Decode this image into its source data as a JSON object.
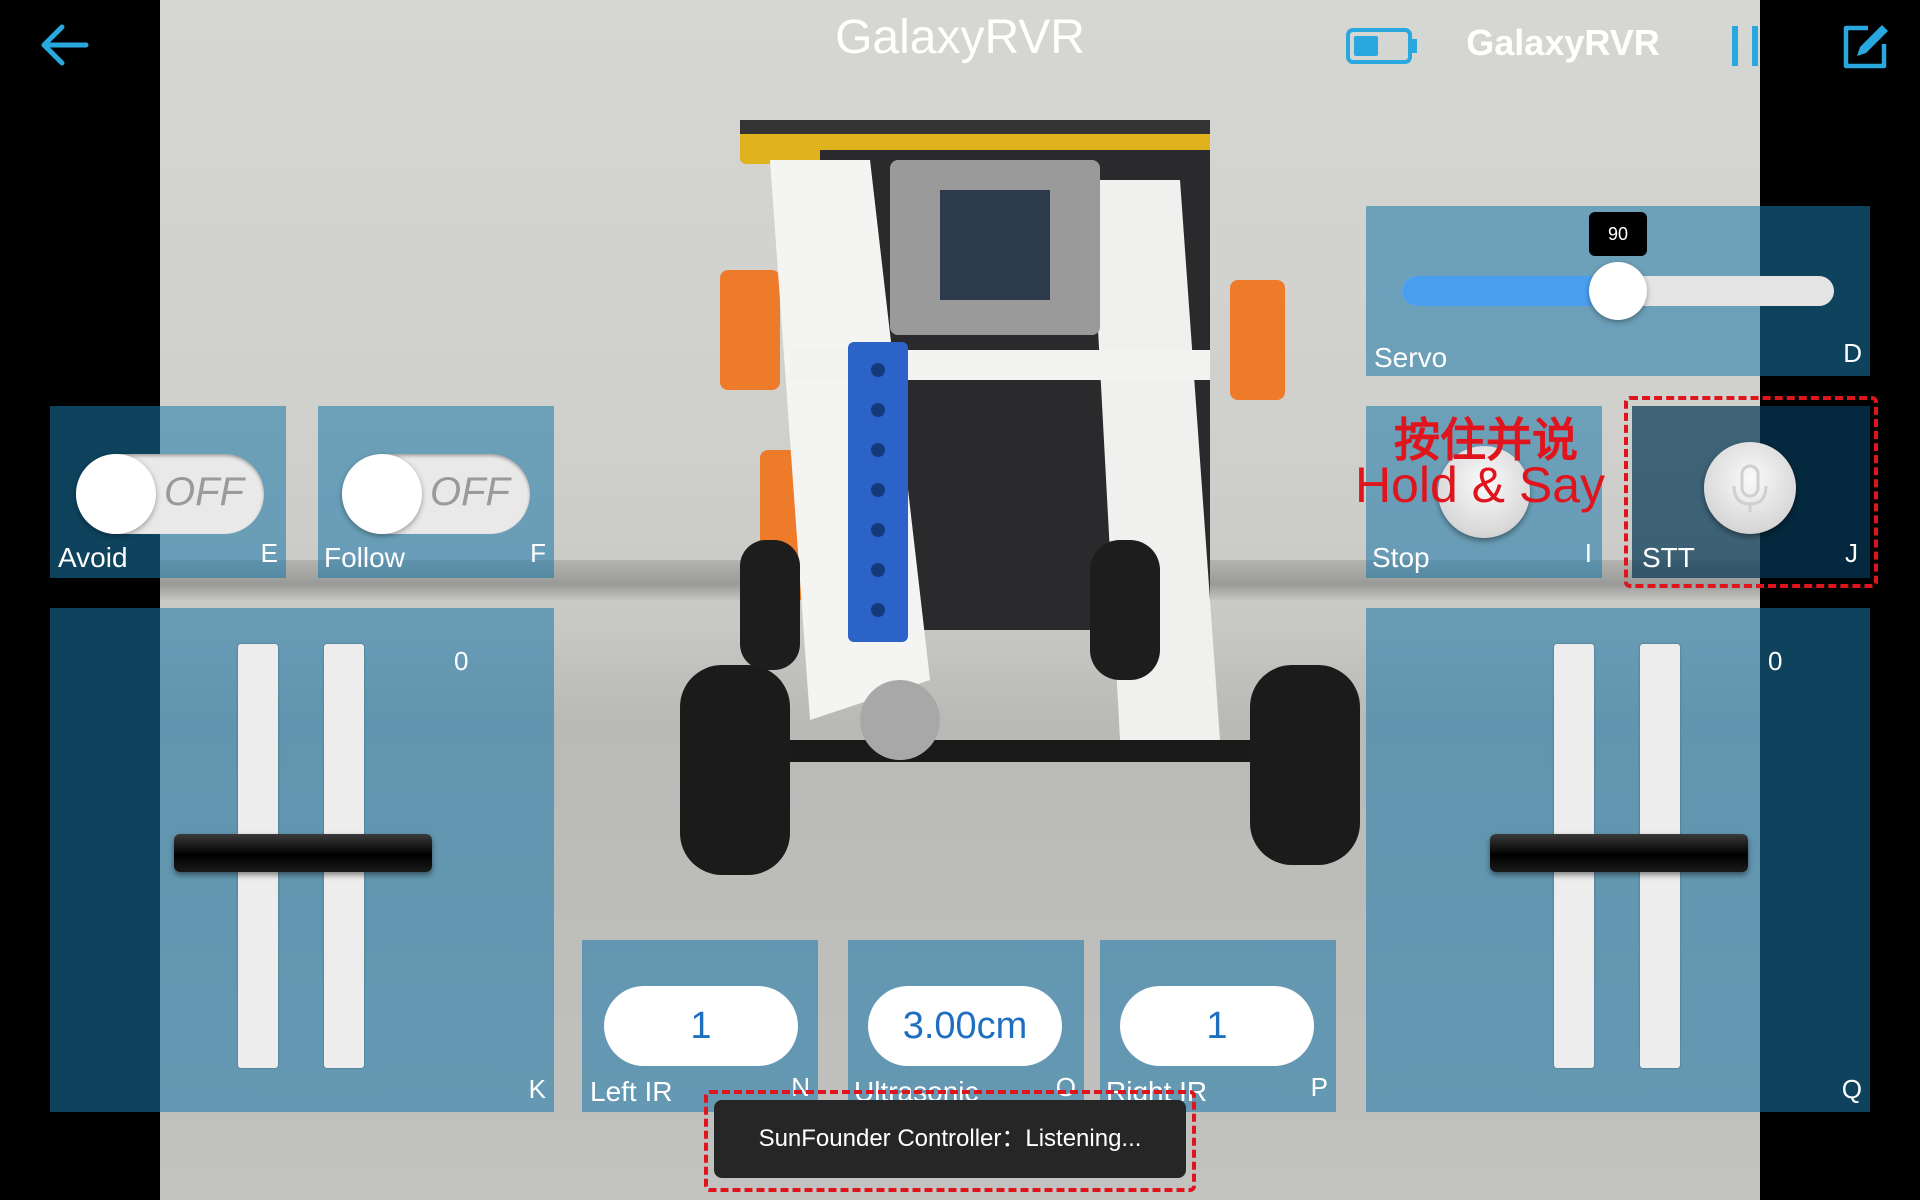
{
  "header": {
    "title": "GalaxyRVR",
    "device_name": "GalaxyRVR"
  },
  "colors": {
    "accent": "#29a8e0",
    "annotation_red": "#e0141c",
    "panel": "#1a78aa"
  },
  "icons": {
    "back": "arrow-left-icon",
    "battery": "battery-icon",
    "pause": "pause-icon",
    "edit": "edit-icon",
    "mic": "microphone-icon"
  },
  "servo": {
    "label": "Servo",
    "key": "D",
    "value": "90",
    "fraction": 0.5
  },
  "avoid": {
    "label": "Avoid",
    "key": "E",
    "state": "OFF"
  },
  "follow": {
    "label": "Follow",
    "key": "F",
    "state": "OFF"
  },
  "stop": {
    "label": "Stop",
    "key": "I"
  },
  "stt": {
    "label": "STT",
    "key": "J"
  },
  "annotation": {
    "hold_cn": "按住并说",
    "hold_en": "Hold & Say"
  },
  "left_throttle": {
    "value": "0",
    "key": "K"
  },
  "right_throttle": {
    "value": "0",
    "key": "Q"
  },
  "left_ir": {
    "label": "Left IR",
    "key": "N",
    "value": "1"
  },
  "ultrasonic": {
    "label": "Ultrasonic",
    "key": "O",
    "value": "3.00cm"
  },
  "right_ir": {
    "label": "Right IR",
    "key": "P",
    "value": "1"
  },
  "toast": {
    "text": "SunFounder Controller：Listening..."
  }
}
